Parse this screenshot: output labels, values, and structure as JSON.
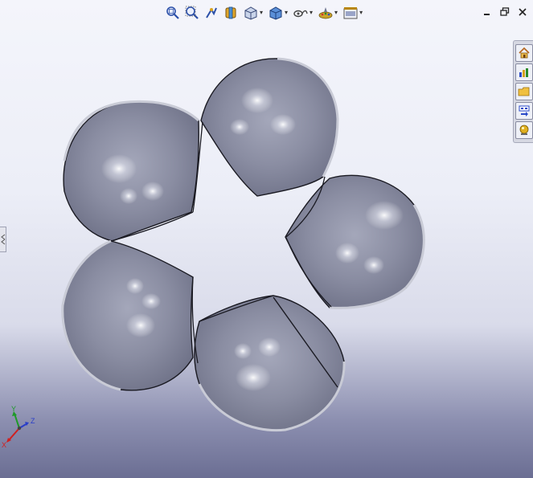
{
  "app": "SolidWorks",
  "toolbar": {
    "items": [
      {
        "icon": "zoom-to-fit-icon",
        "dropdown": false
      },
      {
        "icon": "zoom-to-area-icon",
        "dropdown": false
      },
      {
        "icon": "previous-view-icon",
        "dropdown": false
      },
      {
        "icon": "section-view-icon",
        "dropdown": false
      },
      {
        "icon": "view-orientation-icon",
        "dropdown": true
      },
      {
        "icon": "display-style-icon",
        "dropdown": true
      },
      {
        "icon": "hide-show-items-icon",
        "dropdown": true
      },
      {
        "icon": "edit-appearance-icon",
        "dropdown": true
      },
      {
        "icon": "apply-scene-icon",
        "dropdown": true
      }
    ]
  },
  "window_controls": [
    "minimize-icon",
    "restore-icon",
    "close-icon"
  ],
  "task_pane": {
    "tabs": [
      "home-icon",
      "design-library-icon",
      "file-explorer-icon",
      "view-palette-icon",
      "appearances-icon"
    ]
  },
  "model": {
    "description_name": "five-lobed-twisted-band",
    "colors": {
      "body": "#8c8fa4",
      "edge": "#1a1a22",
      "rim": "#c9cbd6"
    }
  },
  "triad": {
    "x_label": "X",
    "y_label": "Y",
    "z_label": "Z",
    "colors": {
      "x": "#d02020",
      "y": "#1f9a2a",
      "z": "#2a3ec8"
    }
  }
}
